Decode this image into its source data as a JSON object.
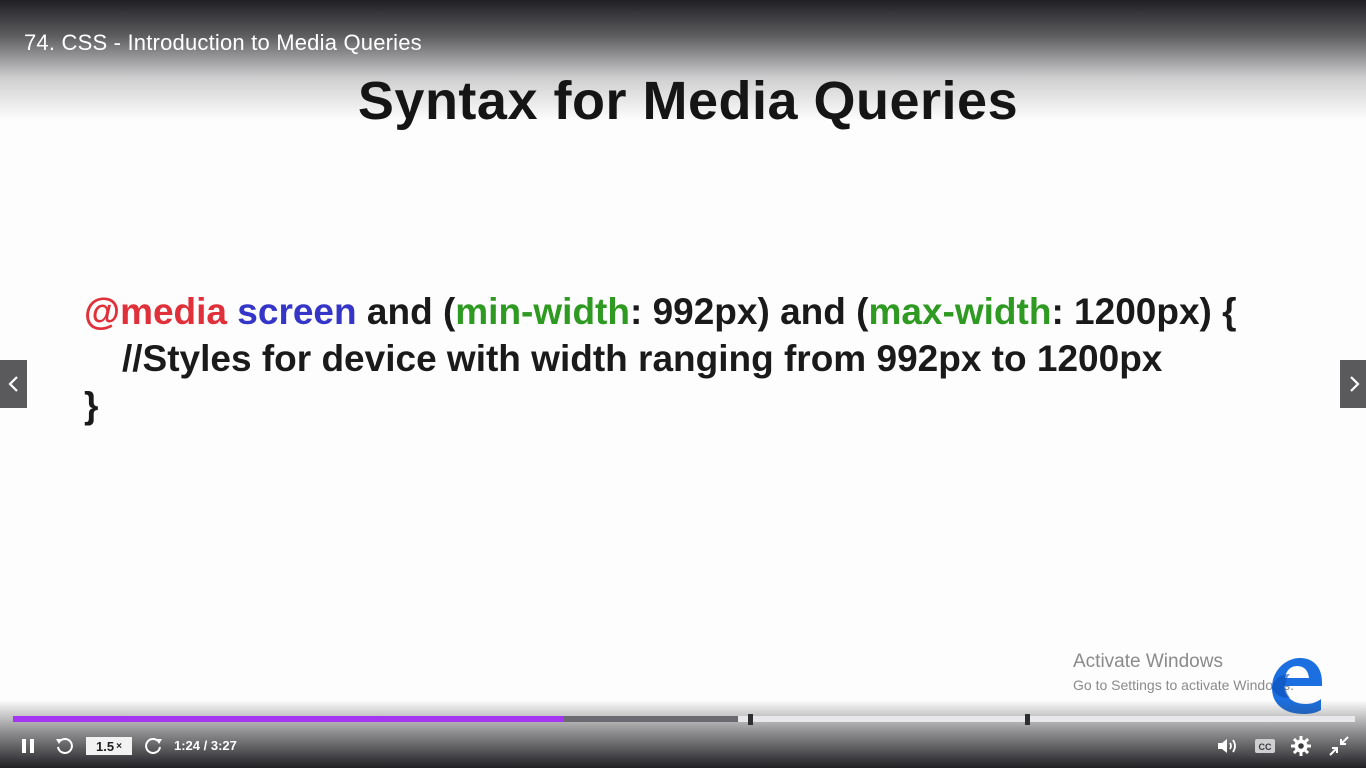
{
  "video": {
    "title": "74. CSS - Introduction to Media Queries"
  },
  "slide": {
    "title": "Syntax for Media Queries",
    "code": {
      "at_rule": "@media",
      "media_type": "screen",
      "and1": " and (",
      "feature1": "min-width",
      "value1": ": 992px) and (",
      "feature2": "max-width",
      "value2": ": 1200px) {",
      "comment": "//Styles for device with width ranging from 992px to 1200px",
      "close": "}"
    }
  },
  "watermark": {
    "title": "Activate Windows",
    "subtitle": "Go to Settings to activate Windows."
  },
  "player": {
    "progress_fraction": 0.4095,
    "buffered_fraction": 0.54,
    "speed": "1.5",
    "speed_suffix": "×",
    "time": "1:24 / 3:27"
  },
  "colors": {
    "progress": "#a435f0",
    "media_keyword": "#e0303a",
    "screen_keyword": "#3535c8",
    "feature_keyword": "#2e9a22"
  },
  "icons": {
    "pause": "pause-icon",
    "rewind": "rewind-icon",
    "forward": "forward-icon",
    "volume": "volume-icon",
    "captions": "captions-icon",
    "settings": "gear-icon",
    "exit_fullscreen": "exit-fullscreen-icon",
    "prev": "chevron-left-icon",
    "next": "chevron-right-icon"
  }
}
